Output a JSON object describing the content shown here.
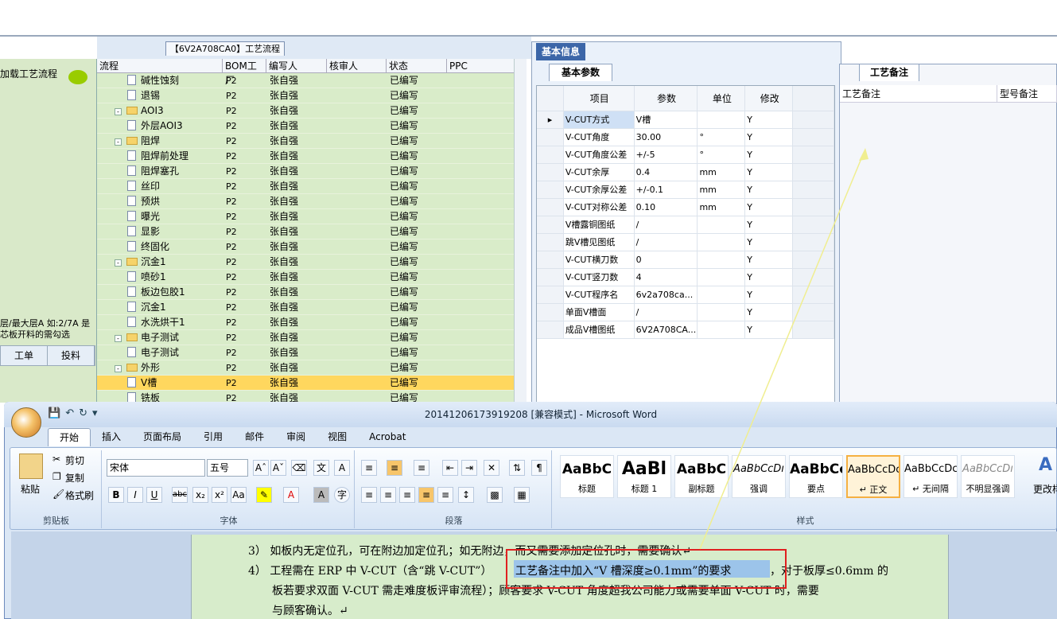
{
  "left_panel": {
    "title": "加载工艺流程",
    "hint": "层/最大层A 如:2/7A 是芯板开料的需勾选",
    "tabs": [
      "工单",
      "投料"
    ]
  },
  "process": {
    "title": "【6V2A708CA0】工艺流程",
    "headers": [
      "流程",
      "BOM工厂",
      "编写人",
      "核审人",
      "状态",
      "PPC"
    ],
    "rows": [
      {
        "name": "碱性蚀刻",
        "level": 2,
        "bom": "P2",
        "author": "张自强",
        "status": "已编写"
      },
      {
        "name": "退锡",
        "level": 2,
        "bom": "P2",
        "author": "张自强",
        "status": "已编写"
      },
      {
        "name": "AOI3",
        "level": 1,
        "bom": "P2",
        "author": "张自强",
        "status": "已编写"
      },
      {
        "name": "外层AOI3",
        "level": 2,
        "bom": "P2",
        "author": "张自强",
        "status": "已编写"
      },
      {
        "name": "阻焊",
        "level": 1,
        "bom": "P2",
        "author": "张自强",
        "status": "已编写"
      },
      {
        "name": "阻焊前处理",
        "level": 2,
        "bom": "P2",
        "author": "张自强",
        "status": "已编写"
      },
      {
        "name": "阻焊塞孔",
        "level": 2,
        "bom": "P2",
        "author": "张自强",
        "status": "已编写"
      },
      {
        "name": "丝印",
        "level": 2,
        "bom": "P2",
        "author": "张自强",
        "status": "已编写"
      },
      {
        "name": "预烘",
        "level": 2,
        "bom": "P2",
        "author": "张自强",
        "status": "已编写"
      },
      {
        "name": "曝光",
        "level": 2,
        "bom": "P2",
        "author": "张自强",
        "status": "已编写"
      },
      {
        "name": "显影",
        "level": 2,
        "bom": "P2",
        "author": "张自强",
        "status": "已编写"
      },
      {
        "name": "终固化",
        "level": 2,
        "bom": "P2",
        "author": "张自强",
        "status": "已编写"
      },
      {
        "name": "沉金1",
        "level": 1,
        "bom": "P2",
        "author": "张自强",
        "status": "已编写"
      },
      {
        "name": "喷砂1",
        "level": 2,
        "bom": "P2",
        "author": "张自强",
        "status": "已编写"
      },
      {
        "name": "板边包胶1",
        "level": 2,
        "bom": "P2",
        "author": "张自强",
        "status": "已编写"
      },
      {
        "name": "沉金1",
        "level": 2,
        "bom": "P2",
        "author": "张自强",
        "status": "已编写"
      },
      {
        "name": "水洗烘干1",
        "level": 2,
        "bom": "P2",
        "author": "张自强",
        "status": "已编写"
      },
      {
        "name": "电子测试",
        "level": 1,
        "bom": "P2",
        "author": "张自强",
        "status": "已编写"
      },
      {
        "name": "电子测试",
        "level": 2,
        "bom": "P2",
        "author": "张自强",
        "status": "已编写"
      },
      {
        "name": "外形",
        "level": 1,
        "bom": "P2",
        "author": "张自强",
        "status": "已编写"
      },
      {
        "name": "V槽",
        "level": 2,
        "bom": "P2",
        "author": "张自强",
        "status": "已编写",
        "selected": true
      },
      {
        "name": "铣板",
        "level": 2,
        "bom": "P2",
        "author": "张自强",
        "status": "已编写"
      }
    ]
  },
  "info": {
    "tab": "基本信息",
    "subtab": "基本参数",
    "headers": [
      "项目",
      "参数",
      "单位",
      "修改"
    ],
    "rows": [
      {
        "item": "V-CUT方式",
        "param": "V槽",
        "unit": "",
        "mod": "Y",
        "current": true
      },
      {
        "item": "V-CUT角度",
        "param": "30.00",
        "unit": "°",
        "mod": "Y"
      },
      {
        "item": "V-CUT角度公差",
        "param": "+/-5",
        "unit": "°",
        "mod": "Y"
      },
      {
        "item": "V-CUT余厚",
        "param": "0.4",
        "unit": "mm",
        "mod": "Y"
      },
      {
        "item": "V-CUT余厚公差",
        "param": "+/-0.1",
        "unit": "mm",
        "mod": "Y"
      },
      {
        "item": "V-CUT对称公差",
        "param": "0.10",
        "unit": "mm",
        "mod": "Y"
      },
      {
        "item": "V槽露铜图纸",
        "param": "/",
        "unit": "",
        "mod": "Y"
      },
      {
        "item": "跳V槽见图纸",
        "param": "/",
        "unit": "",
        "mod": "Y"
      },
      {
        "item": "V-CUT横刀数",
        "param": "0",
        "unit": "",
        "mod": "Y"
      },
      {
        "item": "V-CUT竖刀数",
        "param": "4",
        "unit": "",
        "mod": "Y"
      },
      {
        "item": "V-CUT程序名",
        "param": "6v2a708ca...",
        "unit": "",
        "mod": "Y"
      },
      {
        "item": "单面V槽面",
        "param": "/",
        "unit": "",
        "mod": "Y"
      },
      {
        "item": "成品V槽图纸",
        "param": "6V2A708CA...",
        "unit": "",
        "mod": "Y"
      }
    ]
  },
  "notes": {
    "tab": "工艺备注",
    "cols": [
      "工艺备注",
      "型号备注"
    ]
  },
  "word": {
    "title": "20141206173919208 [兼容模式] - Microsoft Word",
    "tabs": [
      "开始",
      "插入",
      "页面布局",
      "引用",
      "邮件",
      "审阅",
      "视图",
      "Acrobat"
    ],
    "clipboard": {
      "paste": "粘贴",
      "cut": "剪切",
      "copy": "复制",
      "format": "格式刷",
      "label": "剪贴板"
    },
    "font": {
      "name": "宋体",
      "size": "五号",
      "label": "字体"
    },
    "paragraph_label": "段落",
    "styles": [
      {
        "sample": "AaBbC",
        "name": "标题"
      },
      {
        "sample": "AaBl",
        "name": "标题 1"
      },
      {
        "sample": "AaBbC",
        "name": "副标题"
      },
      {
        "sample": "AaBbCcDı",
        "name": "强调"
      },
      {
        "sample": "AaBbCcD",
        "name": "要点"
      },
      {
        "sample": "AaBbCcDc",
        "name": "↵ 正文",
        "active": true
      },
      {
        "sample": "AaBbCcDc",
        "name": "↵ 无间隔"
      },
      {
        "sample": "AaBbCcDı",
        "name": "不明显强调"
      }
    ],
    "styles_label": "样式",
    "change_styles": "更改样"
  },
  "doc": {
    "line1": "3） 如板内无定位孔，可在附边加定位孔；如无附边，而又需要添加定位孔时，需要确认↵",
    "line2_pre": "4） 工程需在 ERP 中 V-CUT（含“跳 V-CUT”）",
    "line2_hl": "工艺备注中加入“V 槽深度≥0.1mm”的要求",
    "line2_post": "，对于板厚≤0.6mm 的",
    "line3": "板若要求双面 V-CUT 需走难度板评审流程）；顾客要求 V-CUT 角度超我公司能力或需要单面 V-CUT 时，需要",
    "line4": "与顾客确认。↵"
  }
}
